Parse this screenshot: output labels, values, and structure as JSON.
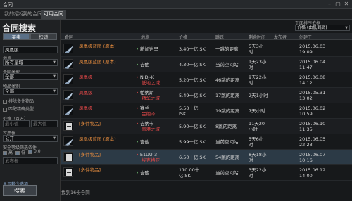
{
  "window": {
    "title": "合同"
  },
  "tabs": [
    "我的招标",
    "我的合同",
    "可用合同"
  ],
  "sidebar": {
    "title": "合同搜索",
    "buy_label": "买卖",
    "courier_label": "快递",
    "search_value": "凤凰级",
    "location_label": "地点",
    "location_value": "所有星域",
    "contract_type_label": "合同类型",
    "contract_type_value": "全部",
    "item_category_label": "物品类别",
    "item_category_value": "全部",
    "exclude_multi_label": "排除多件物品",
    "match_exact_label": "匹配精确类型",
    "price_label": "价格（百万）",
    "min_placeholder": "最小值",
    "max_placeholder": "最大值",
    "availability_label": "可用性",
    "availability_value": "公开",
    "security_label": "安全等级筛选条件",
    "security_values": [
      "高",
      "低",
      "0.0"
    ],
    "issuer_placeholder": "发布者",
    "reset_label": "显示较少选项",
    "search_button": "搜索"
  },
  "sort": {
    "label": "页面排序依据",
    "value": "价格 (由低到高)"
  },
  "columns": [
    "合同",
    "地点",
    "价格",
    "跳跃",
    "剩余时间",
    "发布者",
    "创建于"
  ],
  "rows": [
    {
      "name": "凤凰级蓝图 (原本)",
      "name_class": "ship",
      "loc": [
        "新加达里"
      ],
      "loc_class": [
        "white"
      ],
      "price": [
        "3.40十亿ISK"
      ],
      "jumps": "一跳的距离",
      "time": [
        "5天3小",
        "时"
      ],
      "created": [
        "2015.06.03",
        "19:09"
      ]
    },
    {
      "name": "凤凰级蓝图 (原本)",
      "name_class": "ship",
      "loc": [
        "吉他"
      ],
      "loc_class": [
        "white"
      ],
      "price": [
        "4.30十亿ISK"
      ],
      "jumps": "当前空间站",
      "time": [
        "1天23小",
        "时"
      ],
      "created": [
        "2015.06.04",
        "11:47"
      ]
    },
    {
      "name": "凤凰级",
      "name_class": "red",
      "loc": [
        "NIDJ-K",
        "低地之域"
      ],
      "loc_class": [
        "white",
        "red"
      ],
      "price": [
        "5.20十亿ISK"
      ],
      "jumps": "46跳的距离",
      "time": [
        "9天22小",
        "时"
      ],
      "created": [
        "2015.06.08",
        "14:12"
      ]
    },
    {
      "name": "凤凰级",
      "name_class": "red",
      "loc": [
        "帕纳斯",
        "精华之域"
      ],
      "loc_class": [
        "white",
        "red"
      ],
      "price": [
        "5.49十亿ISK"
      ],
      "jumps": "17跳的距离",
      "time": [
        "2天1小时"
      ],
      "created": [
        "2015.05.31",
        "13:02"
      ]
    },
    {
      "name": "凤凰级",
      "name_class": "red",
      "loc": [
        "赛兰",
        "金纳泽"
      ],
      "loc_class": [
        "white",
        "red"
      ],
      "price": [
        "5.50十亿",
        "ISK"
      ],
      "jumps": "19跳的距离",
      "time": [
        "7天小时"
      ],
      "created": [
        "2015.06.02",
        "10:59"
      ]
    },
    {
      "name": "[多件物品]",
      "name_class": "multi",
      "loc": [
        "吉纳卡",
        "南港之域"
      ],
      "loc_class": [
        "white",
        "red"
      ],
      "price": [
        "5.90十亿ISK"
      ],
      "jumps": "8跳的距离",
      "time": [
        "11天20",
        "小时"
      ],
      "created": [
        "2015.06.10",
        "11:35"
      ]
    },
    {
      "name": "凤凰级蓝图 (原本)",
      "name_class": "ship",
      "loc": [
        "吉他"
      ],
      "loc_class": [
        "white"
      ],
      "price": [
        "5.99十亿ISK"
      ],
      "jumps": "当前空间站",
      "time": [
        "5天6小",
        "时"
      ],
      "created": [
        "2015.06.05",
        "22:23"
      ]
    },
    {
      "name": "[多件物品]",
      "name_class": "multi",
      "loc": [
        "E1UU-3",
        "埃克特亚"
      ],
      "loc_class": [
        "white",
        "red"
      ],
      "price": [
        "6.50十亿ISK"
      ],
      "jumps": "54跳的距离",
      "time": [
        "8天18小",
        "时"
      ],
      "created": [
        "2015.06.07",
        "10:16"
      ]
    },
    {
      "name": "[多件物品]",
      "name_class": "multi",
      "loc": [
        "吉他"
      ],
      "loc_class": [
        "white"
      ],
      "price": [
        "110.00十",
        "亿ISK"
      ],
      "jumps": "当前空间站",
      "time": [
        "3天22小",
        "时"
      ],
      "created": [
        "2015.06.12",
        "14:00"
      ]
    }
  ],
  "footer": "找到16份合同"
}
